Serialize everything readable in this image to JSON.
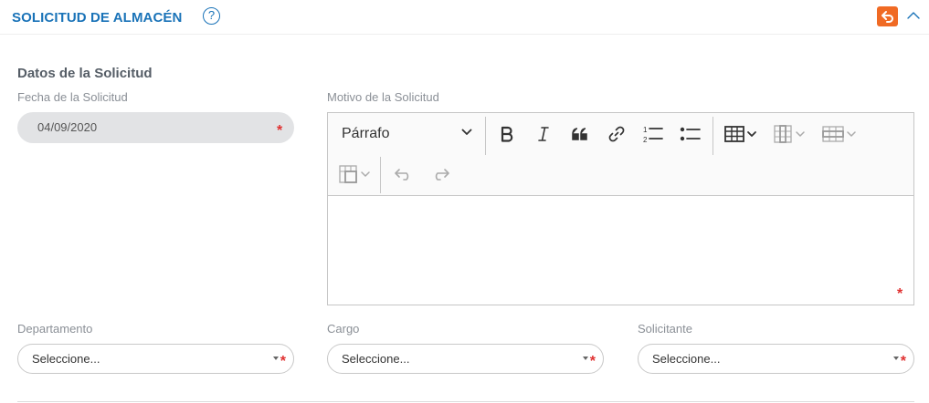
{
  "header": {
    "title": "SOLICITUD DE ALMACÉN",
    "help_glyph": "?",
    "help_icon": "question-circle-icon",
    "back_icon": "undo-arrow-icon",
    "collapse_icon": "chevron-up-icon",
    "accent_color": "#1a73b8",
    "back_color": "#f06a24"
  },
  "section": {
    "title": "Datos de la Solicitud"
  },
  "fecha": {
    "label": "Fecha de la Solicitud",
    "value": "04/09/2020",
    "required_mark": "*"
  },
  "motivo": {
    "label": "Motivo de la Solicitud",
    "paragraph_select": "Párrafo",
    "value": "",
    "required_mark": "*",
    "toolbar_icons": [
      "bold-icon",
      "italic-icon",
      "blockquote-icon",
      "link-icon",
      "numbered-list-icon",
      "bulleted-list-icon",
      "insert-table-icon",
      "table-column-icon",
      "table-row-icon",
      "merge-cells-icon",
      "undo-icon",
      "redo-icon"
    ]
  },
  "departamento": {
    "label": "Departamento",
    "value": "Seleccione...",
    "required_mark": "*"
  },
  "cargo": {
    "label": "Cargo",
    "value": "Seleccione...",
    "required_mark": "*"
  },
  "solicitante": {
    "label": "Solicitante",
    "value": "Seleccione...",
    "required_mark": "*"
  }
}
